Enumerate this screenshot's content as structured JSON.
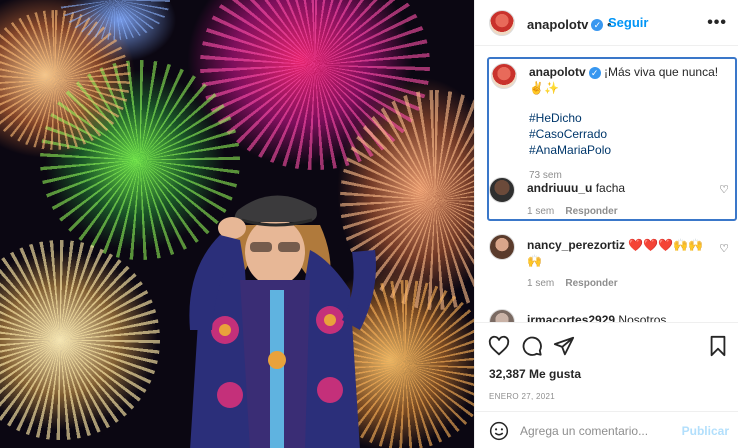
{
  "post": {
    "username": "anapolotv",
    "follow_label": "Seguir",
    "more_label": "•••",
    "caption": {
      "line1": "¡Más viva que nunca!",
      "line2": "✌️✨",
      "hashtag1": "#HeDicho",
      "hashtag2": "#CasoCerrado",
      "hashtag3": "#AnaMariaPolo",
      "time": "73 sem"
    },
    "comments": [
      {
        "username": "andriuuu_u",
        "text": "facha",
        "time": "1 sem",
        "reply": "Responder"
      },
      {
        "username": "nancy_perezortiz",
        "text": "❤️❤️❤️🙌🙌",
        "text2": "🙌",
        "time": "1 sem",
        "reply": "Responder"
      },
      {
        "username": "irmacortes2929",
        "text": "Nosotros"
      }
    ],
    "likes": "32,387 Me gusta",
    "date": "ENERO 27, 2021",
    "comment_placeholder": "Agrega un comentario...",
    "publish_label": "Publicar"
  },
  "colors": {
    "link_blue": "#0095f6",
    "highlight_border": "#3a77c9",
    "hashtag": "#00376b",
    "muted": "#8e8e8e"
  }
}
